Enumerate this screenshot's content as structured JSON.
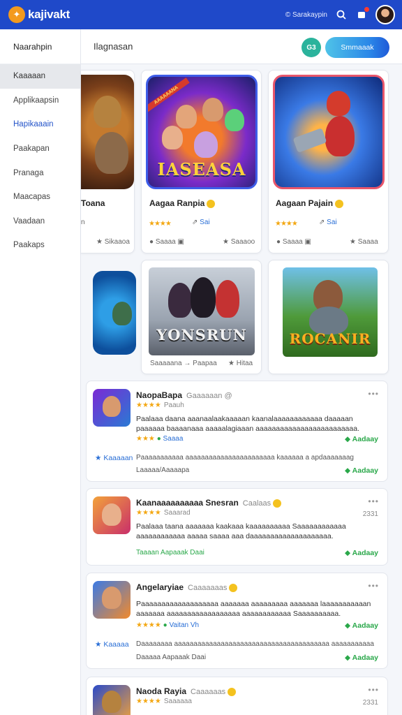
{
  "header": {
    "logo_glyph": "✦",
    "app_name": "kajivakt",
    "top_link": "© Sarakaypin",
    "accent_color": "#1f49c9",
    "icons": [
      "search-icon",
      "bell-icon",
      "avatar"
    ]
  },
  "sidebar": {
    "heading": "Naarahpin",
    "items": [
      {
        "label": "Kaaaaan",
        "state": "active"
      },
      {
        "label": "Applikaapsin",
        "state": ""
      },
      {
        "label": "Hapikaaain",
        "state": "highlight"
      },
      {
        "label": "Paakapan",
        "state": ""
      },
      {
        "label": "Pranaga",
        "state": ""
      },
      {
        "label": "Maacapas",
        "state": ""
      },
      {
        "label": "Vaadaan",
        "state": ""
      },
      {
        "label": "Paakaps",
        "state": ""
      }
    ]
  },
  "toolbar": {
    "title": "Ilagnasan",
    "small_button": "G3",
    "primary_button": "Smmaaak"
  },
  "games_row1": [
    {
      "title": "Toana",
      "stars": "",
      "tag": "n",
      "footer_left": "",
      "footer_right": "Sikaaoa"
    },
    {
      "title": "Aagaa Ranpia",
      "stars": "★★★★",
      "tag": "Sai",
      "footer_left": "Saaaa",
      "footer_right": "Saaaoo",
      "art_text": "IASEASA",
      "ribbon": "AAAAAANA"
    },
    {
      "title": "Aagaan Pajain",
      "stars": "★★★★",
      "tag": "Sai",
      "footer_left": "Saaaa",
      "footer_right": "Saaaa"
    }
  ],
  "games_row2": [
    {
      "art_text": "",
      "footer_left": "",
      "footer_right": ""
    },
    {
      "art_text": "YONSRUN",
      "footer_left": "Saaaaana",
      "footer_middle": "Paapaa",
      "footer_right": "Hitaa"
    },
    {
      "art_text": "ROCANIR",
      "footer_left": "",
      "footer_right": ""
    }
  ],
  "reviews": [
    {
      "name": "NaopaBapa",
      "sub": "Gaaaaaan @",
      "stars": "★★★★",
      "stars_label": "Paauh",
      "count": "",
      "body": "Paalaaa daana aaanaalaakaaaaan kaanalaaaaaaaaaaaa daaaaan paaaaaa baaaanaaa aaaaalagiaaan aaaaaaaaaaaaaaaaaaaaaaaaa.",
      "line1": "Saaaa",
      "action1": "Aadaay",
      "left_link": "Kaaaaan",
      "line2": "Paaaaaaaaaaa aaaaaaaaaaaaaaaaaaaaaaa kaaaaaa a apdaaaaaaag",
      "line3": "Laaaaa/Aaaaapa",
      "action2": "Aadaay"
    },
    {
      "name": "Kaanaaaaaaaaaa Snesran",
      "sub": "Caalaas",
      "stars": "★★★★",
      "stars_label": "Saaarad",
      "count": "2331",
      "body": "Paalaaa taana aaaaaaa kaakaaa kaaaaaaaaaa Saaaaaaaaaaaa aaaaaaaaaaaa aaaaa saaaa aaa daaaaaaaaaaaaaaaaaaaa.",
      "line1": "",
      "action1": "",
      "left_link": "",
      "line2": "",
      "line3": "Taaaan Aapaaak Daai",
      "action2": "Aadaay"
    },
    {
      "name": "Angelaryiae",
      "sub": "Caaaaaaas",
      "stars": "★★★★",
      "stars_label": "Vaitan Vh",
      "count": "",
      "body": "Paaaaaaaaaaaaaaaaaaa aaaaaaa aaaaaaaaa aaaaaaa laaaaaaaaaaan aaaaaaa aaaaaaaaaaaaaaaaaa aaaaaaaaaaaa Saaaaaaaaaa.",
      "line1": "",
      "action1": "Aadaay",
      "left_link": "Kaaaaa",
      "line2": "Daaaaaaaa aaaaaaaaaaaaaaaaaaaaaaaaaaaaaaaaaaaaaaaa aaaaaaaaaaa",
      "line3": "Daaaaa Aapaaak Daai",
      "action2": "Aadaay"
    },
    {
      "name": "Naoda Rayia",
      "sub": "Caaaaaas",
      "stars": "★★★★",
      "stars_label": "Saaaaaa",
      "count": "2331",
      "body": "",
      "line1": "",
      "action1": "",
      "left_link": "",
      "line2": "",
      "line3": "",
      "action2": ""
    }
  ]
}
